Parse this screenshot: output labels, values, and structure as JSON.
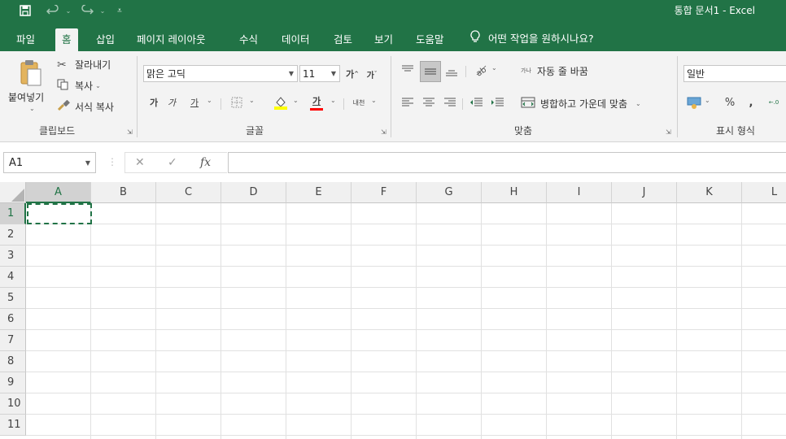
{
  "title_bar": {
    "title": "통합 문서1 - Excel",
    "icons": [
      "save-icon",
      "undo-icon",
      "redo-icon",
      "customize-qat-icon"
    ]
  },
  "tabs": [
    {
      "label": "파일",
      "active": false
    },
    {
      "label": "홈",
      "active": true
    },
    {
      "label": "삽입",
      "active": false
    },
    {
      "label": "페이지 레이아웃",
      "active": false
    },
    {
      "label": "수식",
      "active": false
    },
    {
      "label": "데이터",
      "active": false
    },
    {
      "label": "검토",
      "active": false
    },
    {
      "label": "보기",
      "active": false
    },
    {
      "label": "도움말",
      "active": false
    }
  ],
  "tell_me": "어떤 작업을 원하시나요?",
  "clipboard": {
    "paste": "붙여넣기",
    "cut": "잘라내기",
    "copy": "복사",
    "format_painter": "서식 복사",
    "group_label": "클립보드"
  },
  "font": {
    "font_name": "맑은 고딕",
    "font_size": "11",
    "grow": "가",
    "shrink": "가",
    "bold": "가",
    "italic": "가",
    "underline": "가",
    "font_color_label": "가",
    "phonetic": "내천",
    "group_label": "글꼴",
    "fill_color": "#ffff00",
    "font_color": "#ff0000"
  },
  "alignment": {
    "wrap_text": "자동 줄 바꿈",
    "merge_center": "병합하고 가운데 맞춤",
    "group_label": "맞춤",
    "wrap_icon_text": "가나"
  },
  "number": {
    "format": "일반",
    "percent": "%",
    "comma": ",",
    "group_label": "표시 형식"
  },
  "formula_bar": {
    "name_box": "A1",
    "cancel": "✕",
    "enter": "✓",
    "fx": "fx",
    "value": ""
  },
  "grid": {
    "columns": [
      "A",
      "B",
      "C",
      "D",
      "E",
      "F",
      "G",
      "H",
      "I",
      "J",
      "K",
      "L"
    ],
    "rows": [
      "1",
      "2",
      "3",
      "4",
      "5",
      "6",
      "7",
      "8",
      "9",
      "10",
      "11"
    ],
    "active_cell": "A1"
  },
  "colors": {
    "accent": "#217346",
    "ribbon_bg": "#f3f3f3"
  }
}
